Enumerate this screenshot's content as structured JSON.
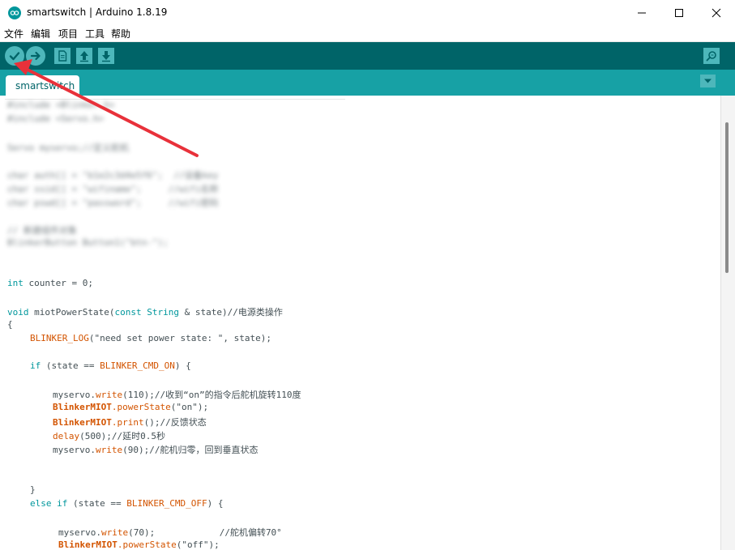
{
  "window": {
    "title": "smartswitch | Arduino 1.8.19",
    "icon": "arduino-logo-icon",
    "controls": [
      "minimize-icon",
      "maximize-icon",
      "close-icon"
    ]
  },
  "menu": [
    "文件",
    "编辑",
    "项目",
    "工具",
    "帮助"
  ],
  "toolbar": {
    "buttons": [
      "verify-check-icon",
      "upload-arrow-icon",
      "new-file-icon",
      "open-icon",
      "save-icon"
    ],
    "right": "serial-monitor-icon"
  },
  "tabs": {
    "active": "smartswitch",
    "menu_icon": "tab-dropdown-icon"
  },
  "colors": {
    "toolbar": "#006468",
    "tabbar": "#17a1a5",
    "button": "#4db7bb",
    "keyword": "#00979c",
    "function": "#d35400",
    "annotation_arrow": "#e8313a"
  },
  "code": {
    "blurred": [
      "#include <Blinker.h>",
      "#include <Servo.h>",
      "Servo myservo;//定义舵机",
      "char auth[] = \"b1e2c3d4e5f6\";  //设备key",
      "char ssid[] = \"wifiname\";     //wifi名称",
      "char pswd[] = \"password\";     //wifi密码",
      "// 新建组件对象",
      "BlinkerButton Button1(\"btn-\");"
    ],
    "line_int_kw": "int",
    "line_int_rest": " counter = 0;",
    "l_void": "void",
    "l_miot": " miotPowerState(",
    "l_const": "const",
    "l_sp": " ",
    "l_String": "String",
    "l_amp": " & state)//电源类操作",
    "l_brace_open": "{",
    "l_log_fn": "BLINKER_LOG",
    "l_log_rest": "(\"need set power state: \", state);",
    "l_if": "if",
    "l_if_rest1": " (state == ",
    "l_if_const": "BLINKER_CMD_ON",
    "l_if_rest2": ") {",
    "l_ms1": "myservo.",
    "l_write": "write",
    "l_ms1_rest": "(110);//收到“on”的指令后舵机旋转110度",
    "l_bm1": "BlinkerMIOT",
    "l_ps": ".powerState",
    "l_ps_rest": "(\"on\");",
    "l_print": ".print",
    "l_print_rest": "();//反馈状态",
    "l_delay": "delay",
    "l_delay_rest": "(500);//延时0.5秒",
    "l_ms2": "myservo.",
    "l_ms2_rest": "(90);//舵机归零，回到垂直状态",
    "l_close1": "}",
    "l_else": "else",
    "l_elseif": "if",
    "l_else_rest1": " (state == ",
    "l_else_const": "BLINKER_CMD_OFF",
    "l_else_rest2": ") {",
    "l_ms3": "myservo.",
    "l_ms3_rest": "(70);            //舵机偏转70°",
    "l_bm3": "BlinkerMIOT",
    "l_ps3_rest": "(\"off\");"
  }
}
